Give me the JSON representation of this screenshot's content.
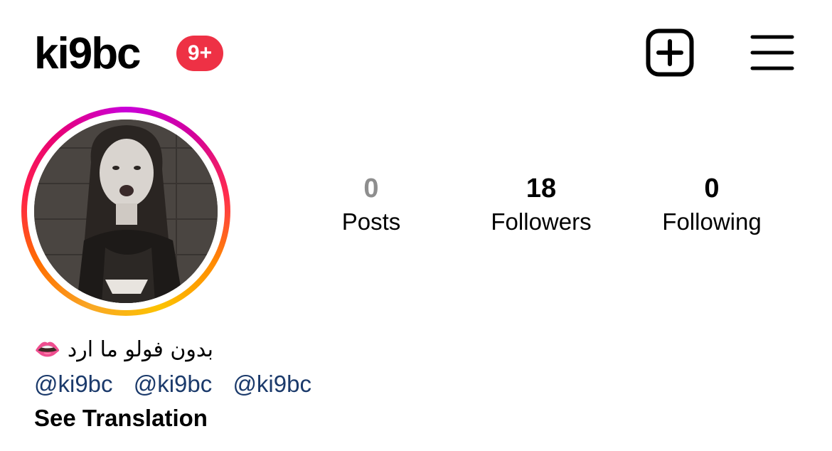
{
  "header": {
    "username": "ki9bc",
    "notification_badge": "9+",
    "badge_color": "#ee3145",
    "add_icon": "plus-square-icon",
    "menu_icon": "hamburger-menu-icon"
  },
  "stats": {
    "posts": {
      "value": "0",
      "label": "Posts"
    },
    "followers": {
      "value": "18",
      "label": "Followers"
    },
    "following": {
      "value": "0",
      "label": "Following"
    }
  },
  "bio": {
    "text": "بدون فولو ما ارد 👄",
    "mentions": [
      "@ki9bc",
      "@ki9bc",
      "@ki9bc"
    ],
    "see_translation": "See Translation",
    "mention_color": "#1b3a6b"
  }
}
